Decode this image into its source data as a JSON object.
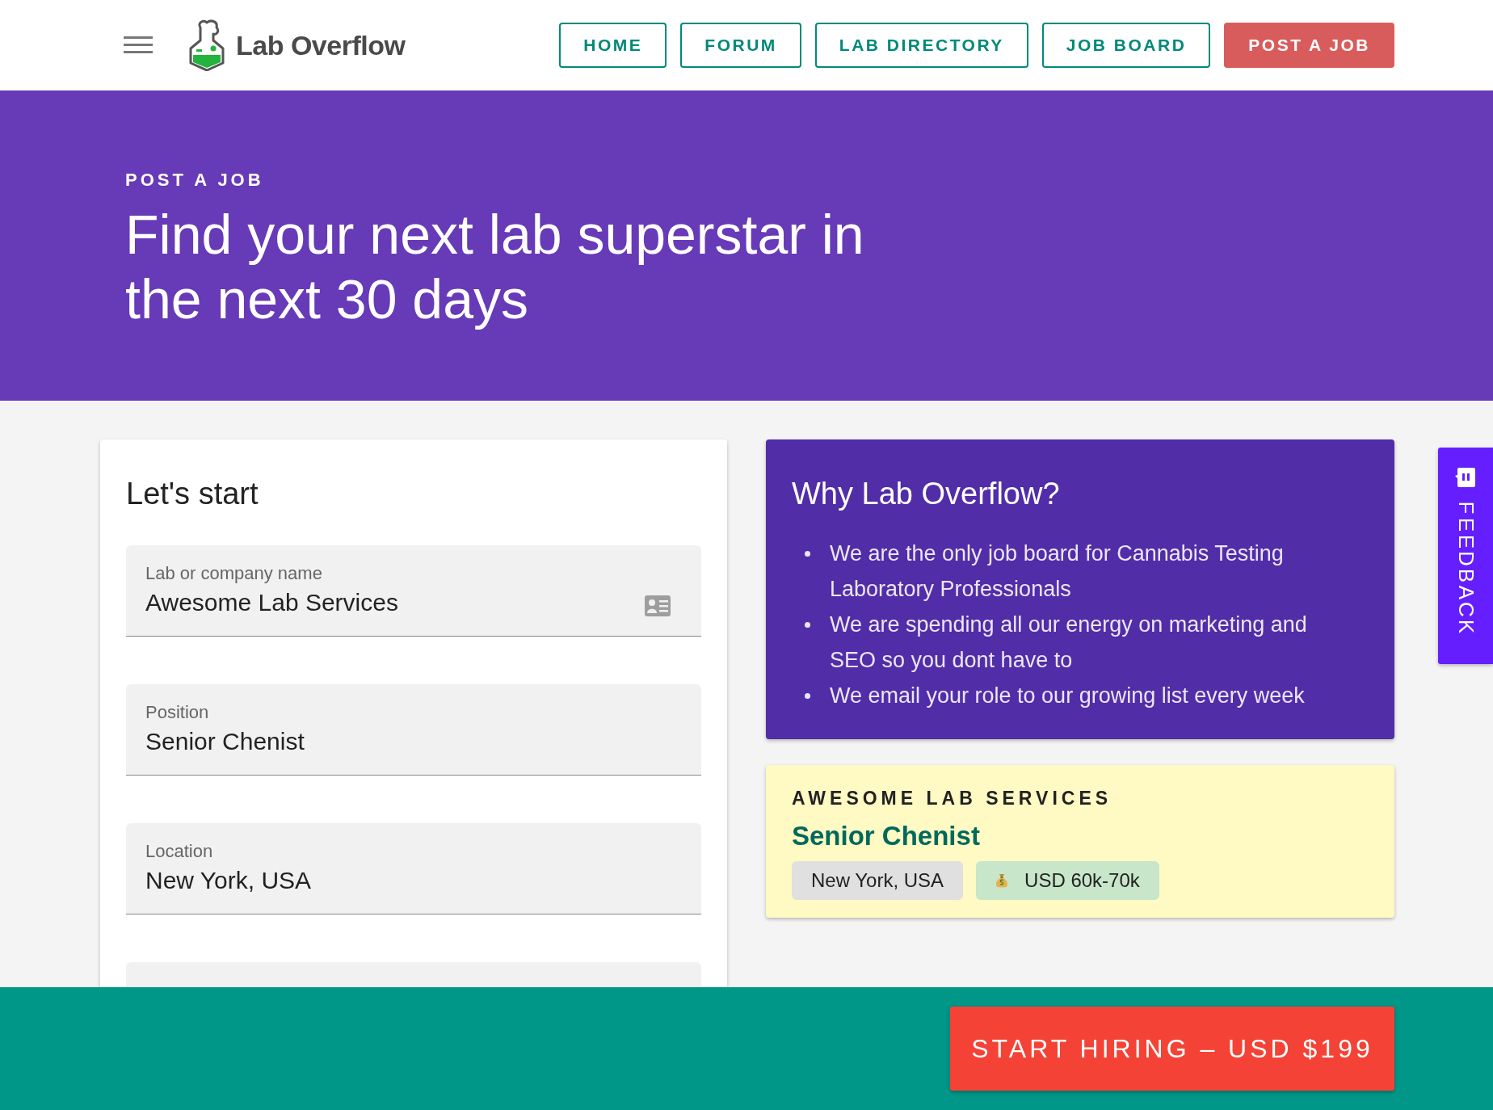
{
  "header": {
    "logo": "Lab Overflow",
    "nav": [
      {
        "label": "HOME",
        "kind": "outline"
      },
      {
        "label": "FORUM",
        "kind": "outline"
      },
      {
        "label": "LAB DIRECTORY",
        "kind": "outline"
      },
      {
        "label": "JOB BOARD",
        "kind": "outline"
      },
      {
        "label": "POST A JOB",
        "kind": "primary"
      }
    ]
  },
  "hero": {
    "eyebrow": "POST A JOB",
    "headline": "Find your next lab superstar in the next 30 days"
  },
  "form": {
    "title": "Let's start",
    "fields": [
      {
        "kind": "contact",
        "label": "Lab or company name",
        "value": "Awesome Lab Services"
      },
      {
        "kind": "plain",
        "label": "Position",
        "value": "Senior Chenist"
      },
      {
        "kind": "plain",
        "label": "Location",
        "value": "New York, USA"
      },
      {
        "kind": "cut"
      }
    ]
  },
  "why": {
    "title": "Why Lab Overflow?",
    "points": [
      "We are the only job board for Cannabis Testing Laboratory Professionals",
      "We are spending all our energy on marketing and SEO so you dont have to",
      "We email your role to our growing list every week"
    ]
  },
  "preview": {
    "company": "AWESOME LAB SERVICES",
    "position": "Senior Chenist",
    "tags": [
      {
        "kind": "location",
        "text": "New York, USA"
      },
      {
        "kind": "salary",
        "text": "USD 60k-70k"
      }
    ]
  },
  "feedback": {
    "label": "FEEDBACK"
  },
  "footer": {
    "button": "START HIRING – USD $199"
  }
}
